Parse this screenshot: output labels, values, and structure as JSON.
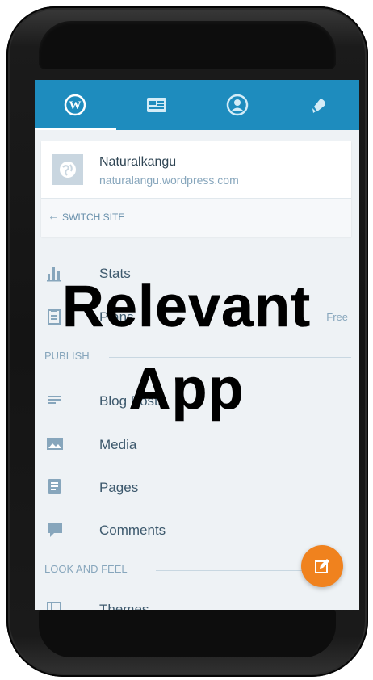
{
  "tabs": [
    {
      "label": "My Sites",
      "icon": "wordpress-icon",
      "active": true
    },
    {
      "label": "Reader",
      "icon": "reader-icon",
      "active": false
    },
    {
      "label": "Me",
      "icon": "profile-icon",
      "active": false
    },
    {
      "label": "Notifications",
      "icon": "bell-icon",
      "active": false
    }
  ],
  "site": {
    "name": "Naturalkangu",
    "url": "naturalangu.wordpress.com",
    "switch_label": "SWITCH SITE"
  },
  "menu": {
    "stats_label": "Stats",
    "plans_label": "Plans",
    "plans_value": "Free",
    "publish_section": "PUBLISH",
    "blog_posts_label": "Blog Posts",
    "media_label": "Media",
    "pages_label": "Pages",
    "comments_label": "Comments",
    "look_section": "LOOK AND FEEL",
    "themes_label": "Themes"
  },
  "overlay": {
    "line1": "Relevant",
    "line2": "App"
  },
  "colors": {
    "accent": "#1e8cbe",
    "fab": "#f0821e",
    "background": "#eef2f5"
  }
}
